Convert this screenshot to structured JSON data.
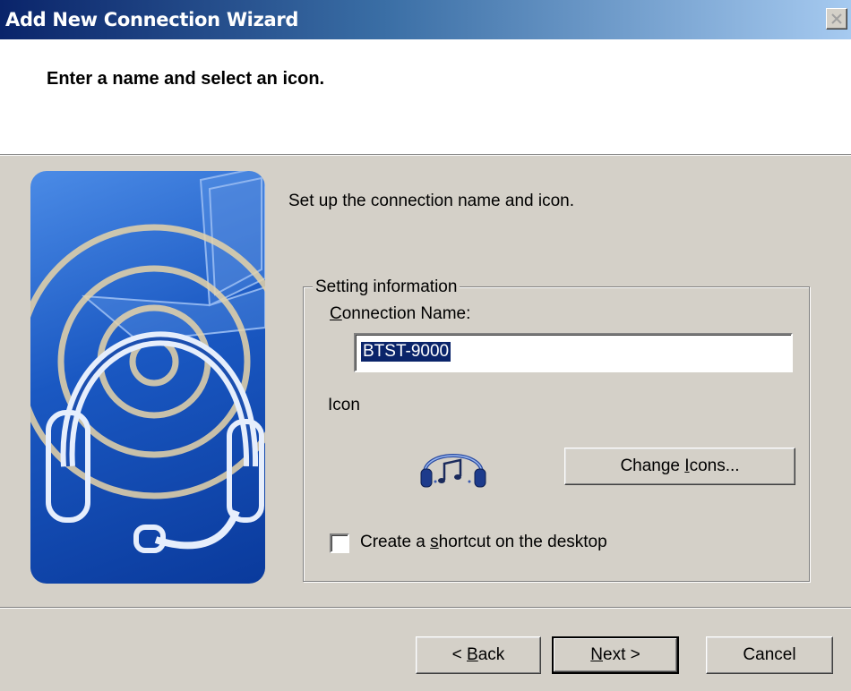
{
  "window": {
    "title": "Add New Connection Wizard"
  },
  "header": {
    "title": "Enter a name and select an icon."
  },
  "body": {
    "intro": "Set up the connection name and icon."
  },
  "group": {
    "legend": "Setting information",
    "connection_name_label_accel": "C",
    "connection_name_label_rest": "onnection Name:",
    "connection_name_value": "BTST-9000",
    "icon_label": "Icon",
    "change_icons_pre": "Change ",
    "change_icons_accel": "I",
    "change_icons_post": "cons...",
    "shortcut_pre": "Create a ",
    "shortcut_accel": "s",
    "shortcut_post": "hortcut on the desktop",
    "shortcut_checked": false
  },
  "footer": {
    "back_pre": "< ",
    "back_accel": "B",
    "back_post": "ack",
    "next_accel": "N",
    "next_post": "ext >",
    "cancel_label": "Cancel"
  },
  "icons": {
    "close": "close-icon",
    "wizard_image": "headset-waves-illustration",
    "connection_icon": "headset-music-icon"
  },
  "colors": {
    "title_start": "#0a246a",
    "title_end": "#a6caf0",
    "selection": "#0a246a",
    "face": "#d4d0c8"
  }
}
